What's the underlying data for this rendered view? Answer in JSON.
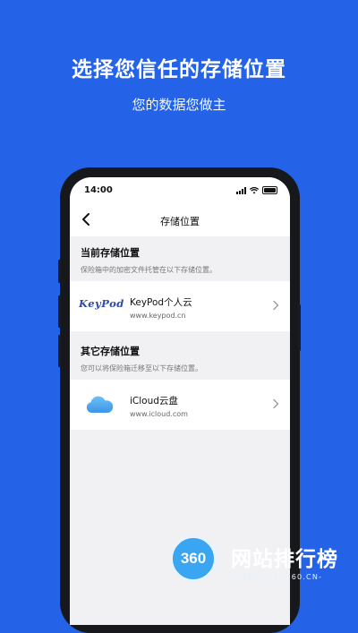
{
  "hero": {
    "title": "选择您信任的存储位置",
    "subtitle": "您的数据您做主"
  },
  "status_bar": {
    "time": "14:00",
    "icons": [
      "cellular-signal-icon",
      "wifi-icon",
      "battery-icon"
    ]
  },
  "nav": {
    "back_icon": "chevron-left-icon",
    "title": "存储位置"
  },
  "current_section": {
    "title": "当前存储位置",
    "description": "保险箱中的加密文件托管在以下存储位置。",
    "item": {
      "logo_text": "KeyPod",
      "name": "KeyPod个人云",
      "url": "www.keypod.cn"
    }
  },
  "other_section": {
    "title": "其它存储位置",
    "description": "您可以将保险箱迁移至以下存储位置。",
    "item": {
      "icon": "cloud-icon",
      "name": "iCloud云盘",
      "url": "www.icloud.com"
    }
  },
  "watermark": {
    "badge": "360",
    "text": "网站排行榜",
    "url": "-WANGZHAN360.CN-"
  },
  "colors": {
    "background": "#2463e8",
    "screen_bg": "#f1f1f4",
    "keypod_brand": "#2f4aa7",
    "icloud_blue": "#4aa8f0"
  }
}
